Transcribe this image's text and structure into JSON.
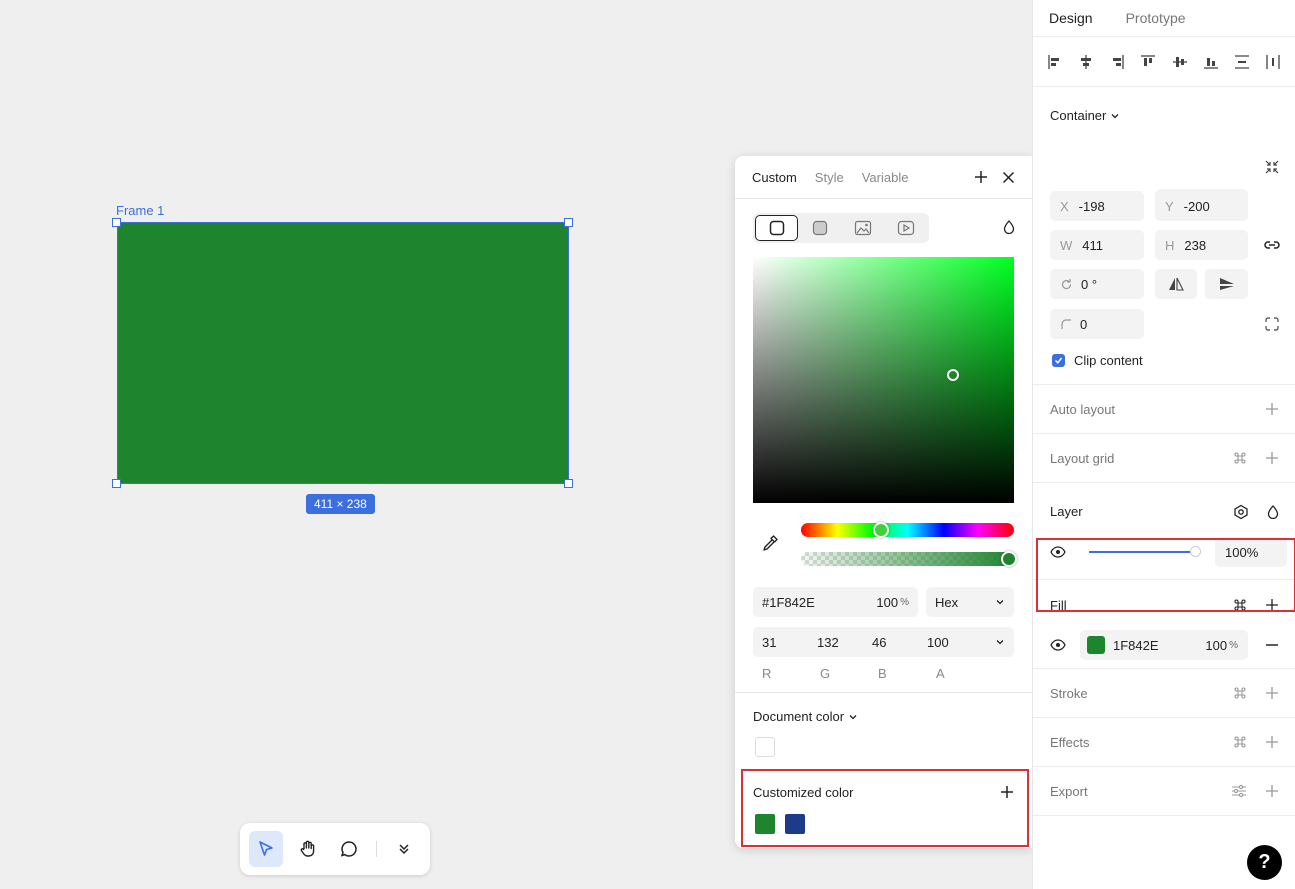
{
  "canvas": {
    "frame_label": "Frame 1",
    "size_badge": "411 × 238",
    "frame_fill": "#1F842E"
  },
  "toolbar": {
    "tools": [
      "cursor-icon",
      "hand-icon",
      "comment-icon",
      "chevrons-down-icon"
    ]
  },
  "picker": {
    "tabs": [
      "Custom",
      "Style",
      "Variable"
    ],
    "hex": "#1F842E",
    "opacity": "100",
    "pct_symbol": "%",
    "mode": "Hex",
    "rgba": {
      "r": "31",
      "g": "132",
      "b": "46",
      "a": "100"
    },
    "rgba_labels": [
      "R",
      "G",
      "B",
      "A"
    ],
    "document_color_title": "Document color",
    "customized_color_title": "Customized color",
    "custom_swatches": [
      "#1F842E",
      "#1E3A8A"
    ],
    "accent_red": "#D9303A"
  },
  "panel": {
    "tabs": [
      "Design",
      "Prototype"
    ],
    "container_label": "Container",
    "x_label": "X",
    "x": "-198",
    "y_label": "Y",
    "y": "-200",
    "w_label": "W",
    "w": "411",
    "h_label": "H",
    "h": "238",
    "rotation": "0 °",
    "radius": "0",
    "clip_content": "Clip content",
    "auto_layout": "Auto layout",
    "layout_grid": "Layout grid",
    "layer": "Layer",
    "layer_opacity": "100",
    "fill": "Fill",
    "fill_hex": "1F842E",
    "fill_opacity": "100",
    "stroke": "Stroke",
    "effects": "Effects",
    "export": "Export",
    "help": "?"
  }
}
